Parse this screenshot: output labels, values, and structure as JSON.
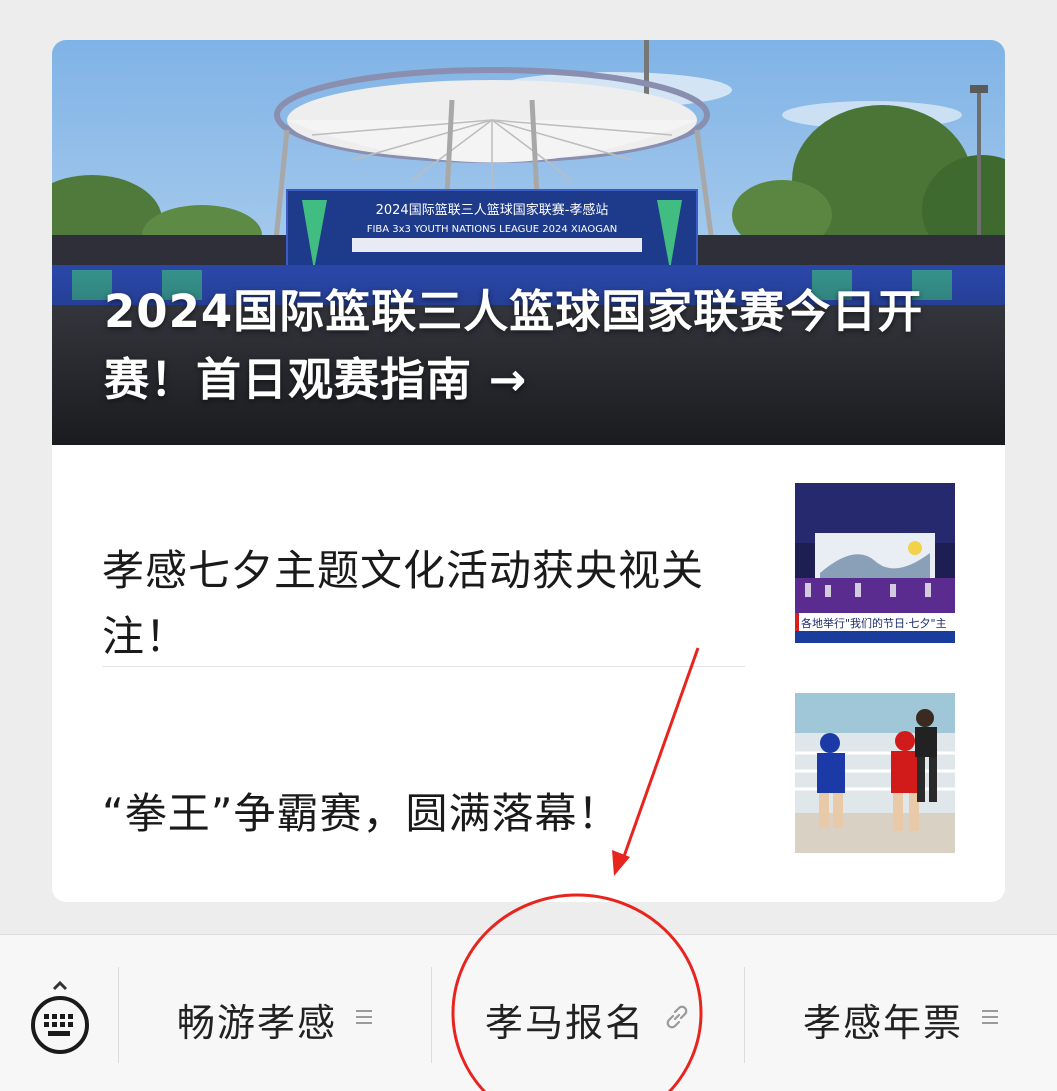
{
  "hero": {
    "title": "2024国际篮联三人篮球国家联赛今日开赛！首日观赛指南 →",
    "banner_line1": "2024国际篮联三人篮球国家联赛-孝感站",
    "banner_line2": "FIBA 3x3 YOUTH NATIONS LEAGUE 2024 XIAOGAN"
  },
  "articles": [
    {
      "title": "孝感七夕主题文化活动获央视关注！",
      "thumb_caption": "各地举行\"我们的节日·七夕\"主"
    },
    {
      "title": "“拳王”争霸赛，圆满落幕！"
    }
  ],
  "menu": {
    "keyboard_icon": "keyboard-icon",
    "items": [
      {
        "label": "畅游孝感",
        "icon": "submenu-icon"
      },
      {
        "label": "孝马报名",
        "icon": "link-icon"
      },
      {
        "label": "孝感年票",
        "icon": "submenu-icon"
      }
    ]
  },
  "colors": {
    "background": "#ededed",
    "card": "#ffffff",
    "menubar": "#f7f7f7",
    "annotation_red": "#e8241e"
  }
}
